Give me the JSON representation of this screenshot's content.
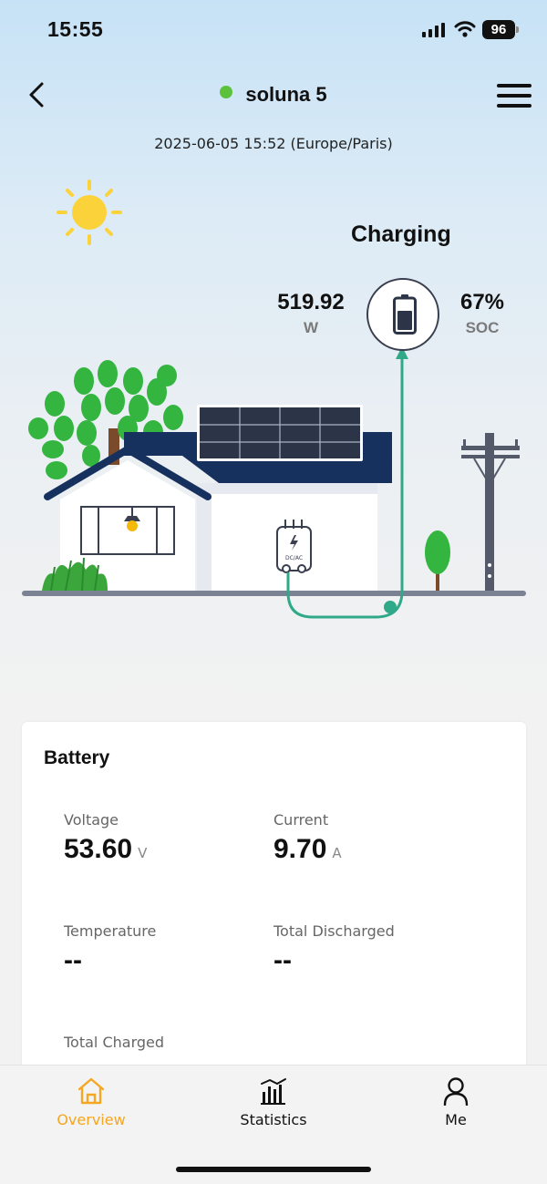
{
  "status_bar": {
    "time": "15:55",
    "battery_level": "96",
    "icons": [
      "cellular-signal-icon",
      "wifi-icon",
      "battery-icon"
    ]
  },
  "header": {
    "title": "soluna 5",
    "online_color": "#5cc23b",
    "timestamp": "2025-06-05 15:52 (Europe/Paris)"
  },
  "energy_flow": {
    "status": "Charging",
    "power_value": "519.92",
    "power_unit": "W",
    "soc_value": "67%",
    "soc_label": "SOC",
    "soc_fraction": 0.67,
    "inverter_label": "DC/AC",
    "flow_color": "#2fa988"
  },
  "battery_card": {
    "title": "Battery",
    "metrics": [
      {
        "label": "Voltage",
        "value": "53.60",
        "unit": "V"
      },
      {
        "label": "Current",
        "value": "9.70",
        "unit": "A"
      },
      {
        "label": "Temperature",
        "value": "--",
        "unit": ""
      },
      {
        "label": "Total Discharged",
        "value": "--",
        "unit": ""
      },
      {
        "label": "Total Charged",
        "value": "",
        "unit": ""
      }
    ]
  },
  "nav": {
    "active_color": "#f5a623",
    "items": [
      {
        "label": "Overview",
        "icon": "home-icon"
      },
      {
        "label": "Statistics",
        "icon": "bar-chart-icon"
      },
      {
        "label": "Me",
        "icon": "user-icon"
      }
    ]
  }
}
